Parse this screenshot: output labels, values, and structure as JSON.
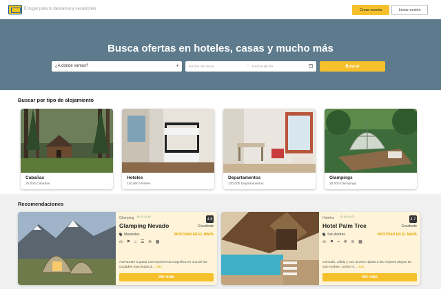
{
  "header": {
    "tagline": "El lugar para tu descanso y vacaciones",
    "create_account_label": "Crear cuenta",
    "login_label": "Iniciar sesión"
  },
  "hero": {
    "title": "Busca ofertas en hoteles, casas y mucho más",
    "destination_placeholder": "¿A dónde vamos?",
    "date_start_placeholder": "Fecha de inicio",
    "date_separator": "–",
    "date_end_placeholder": "Fecha de fin",
    "search_label": "Buscar"
  },
  "types": {
    "title": "Buscar por tipo de alojamiento",
    "items": [
      {
        "name": "Cabañas",
        "count": "25.000 Cabañas"
      },
      {
        "name": "Hoteles",
        "count": "110.000 Hoteles"
      },
      {
        "name": "Departamentos",
        "count": "120.000 Departamentos"
      },
      {
        "name": "Glampings",
        "count": "10.000 Glampings"
      }
    ]
  },
  "recommendations": {
    "title": "Recomendaciones",
    "items": [
      {
        "category": "Glamping",
        "stars": "☆☆☆☆",
        "name": "Glamping Nevado",
        "score": "4.8",
        "score_label": "Excelente",
        "location": "Manizales",
        "map_label": "MOSTRAR EN EL MAPA",
        "amenities": "⛀ ⚑ ⌂ ☰ ≋ ▦",
        "description": "Aventurate a pasar una experiencia magnifica en una de las ciudades mas lindas d...",
        "more_label": "más",
        "button_label": "Ver más"
      },
      {
        "category": "Hoteles",
        "stars": "☆☆☆☆",
        "name": "Hotel Palm Tree",
        "score": "4.7",
        "score_label": "Excelente",
        "location": "San Andres",
        "map_label": "MOSTRAR EN EL MAPA",
        "amenities": "⛀ ⚑ ≈ ✲ ≋ ▦",
        "description": "Cómodo, cálido y con acceso rápido a las mejores playas de San Andres, confort e...",
        "more_label": "más",
        "button_label": "Ver más"
      }
    ]
  }
}
